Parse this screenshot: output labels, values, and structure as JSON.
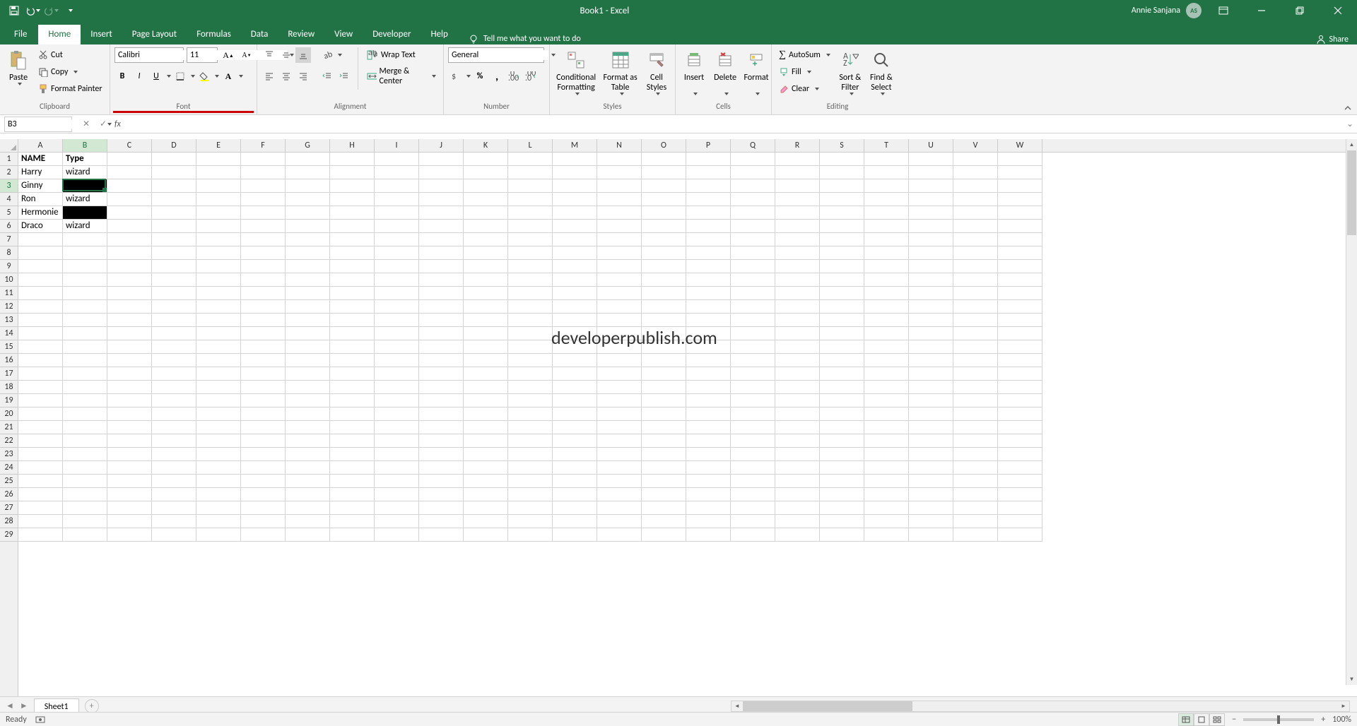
{
  "title_app": "Book1  -  Excel",
  "user_name": "Annie Sanjana",
  "user_initials": "AS",
  "share_label": "Share",
  "tabs": [
    "File",
    "Home",
    "Insert",
    "Page Layout",
    "Formulas",
    "Data",
    "Review",
    "View",
    "Developer",
    "Help"
  ],
  "active_tab": "Home",
  "tell_me": "Tell me what you want to do",
  "clipboard": {
    "paste": "Paste",
    "cut": "Cut",
    "copy": "Copy",
    "format_painter": "Format Painter",
    "label": "Clipboard"
  },
  "font": {
    "name": "Calibri",
    "size": "11",
    "label": "Font"
  },
  "alignment": {
    "wrap": "Wrap Text",
    "merge": "Merge & Center",
    "label": "Alignment"
  },
  "number": {
    "format": "General",
    "label": "Number"
  },
  "styles": {
    "cond": "Conditional\nFormatting",
    "table": "Format as\nTable",
    "cell": "Cell\nStyles",
    "label": "Styles"
  },
  "cells": {
    "insert": "Insert",
    "delete": "Delete",
    "format": "Format",
    "label": "Cells"
  },
  "editing": {
    "autosum": "AutoSum",
    "fill": "Fill",
    "clear": "Clear",
    "sort": "Sort &\nFilter",
    "find": "Find &\nSelect",
    "label": "Editing"
  },
  "namebox_value": "B3",
  "formula_value": "",
  "columns": [
    "A",
    "B",
    "C",
    "D",
    "E",
    "F",
    "G",
    "H",
    "I",
    "J",
    "K",
    "L",
    "M",
    "N",
    "O",
    "P",
    "Q",
    "R",
    "S",
    "T",
    "U",
    "V",
    "W"
  ],
  "active_col_index": 1,
  "active_row_index": 2,
  "row_count": 29,
  "cell_data": {
    "r1": {
      "A": "NAME",
      "B": "Type"
    },
    "r2": {
      "A": "Harry",
      "B": "wizard"
    },
    "r3": {
      "A": "Ginny",
      "B": ""
    },
    "r4": {
      "A": "Ron",
      "B": "wizard"
    },
    "r5": {
      "A": "Hermonie",
      "B": ""
    },
    "r6": {
      "A": "Draco",
      "B": "wizard"
    }
  },
  "black_fill_cells": [
    "B3",
    "B5"
  ],
  "sheet_name": "Sheet1",
  "status_text": "Ready",
  "zoom": "100%",
  "watermark": "developerpublish.com"
}
